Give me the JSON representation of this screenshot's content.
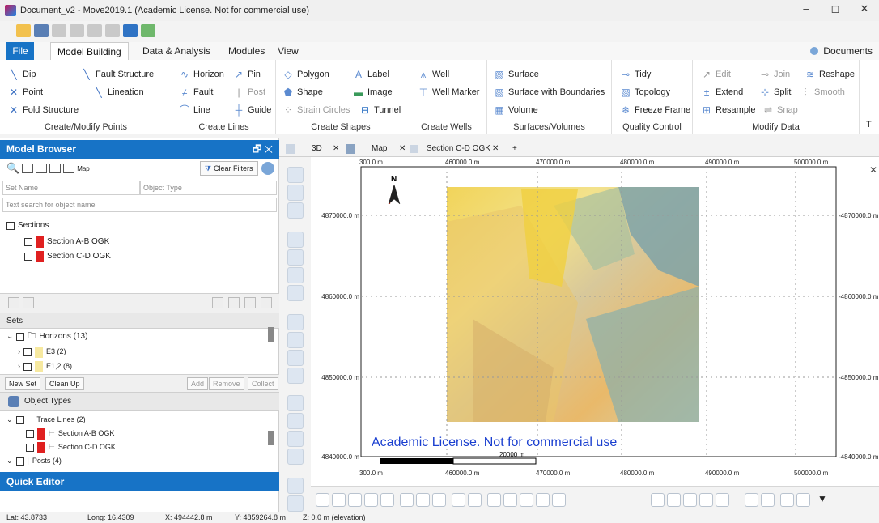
{
  "window": {
    "title": "Document_v2 - Move2019.1 (Academic License. Not for commercial use)",
    "minimize": "–",
    "restore": "◻",
    "close": "✕"
  },
  "ribbon_tabs": [
    "File",
    "Model Building",
    "Data & Analysis",
    "Modules",
    "View"
  ],
  "documents_label": "Documents",
  "ribbon": {
    "points": {
      "dip": "Dip",
      "fault_structure": "Fault Structure",
      "point": "Point",
      "lineation": "Lineation",
      "fold_structure": "Fold Structure",
      "label": "Create/Modify Points"
    },
    "lines": {
      "horizon": "Horizon",
      "pin": "Pin",
      "fault": "Fault",
      "post": "Post",
      "line": "Line",
      "guide": "Guide",
      "label": "Create Lines"
    },
    "shapes": {
      "polygon": "Polygon",
      "label_btn": "Label",
      "shape": "Shape",
      "image": "Image",
      "strain_circles": "Strain Circles",
      "tunnel": "Tunnel",
      "label": "Create Shapes"
    },
    "wells": {
      "well": "Well",
      "well_marker": "Well Marker",
      "label": "Create Wells"
    },
    "surfaces": {
      "surface": "Surface",
      "surface_boundaries": "Surface with Boundaries",
      "volume": "Volume",
      "label": "Surfaces/Volumes"
    },
    "quality": {
      "tidy": "Tidy",
      "topology": "Topology",
      "freeze_frame": "Freeze Frame",
      "label": "Quality Control"
    },
    "modify": {
      "edit": "Edit",
      "join": "Join",
      "reshape": "Reshape",
      "extend": "Extend",
      "split": "Split",
      "smooth": "Smooth",
      "resample": "Resample",
      "snap": "Snap",
      "label": "Modify Data"
    },
    "trunc": "T"
  },
  "model_browser": {
    "title": "Model Browser",
    "map_label": "Map",
    "clear_filters": "Clear Filters",
    "set_name_placeholder": "Set Name",
    "object_type_placeholder": "Object Type",
    "search_placeholder": "Text search for object name",
    "sections_label": "Sections",
    "sections": [
      {
        "name": "Section A-B OGK",
        "color": "#e02020"
      },
      {
        "name": "Section C-D OGK",
        "color": "#e02020"
      }
    ],
    "sets_label": "Sets",
    "horizons_label": "Horizons (13)",
    "horizon_items": [
      {
        "name": "E3 (2)",
        "color": "#f7e9a0"
      },
      {
        "name": "E1,2 (8)",
        "color": "#f7e9a0"
      }
    ],
    "buttons": {
      "new_set": "New Set",
      "clean_up": "Clean Up",
      "add": "Add",
      "remove": "Remove",
      "collect": "Collect"
    },
    "object_types_label": "Object Types",
    "trace_lines_label": "Trace Lines (2)",
    "trace_items": [
      "Section A-B OGK",
      "Section C-D OGK"
    ],
    "posts_label": "Posts (4)"
  },
  "quick_editor": "Quick Editor",
  "view_tabs": {
    "three_d": "3D",
    "map": "Map",
    "section": "Section C-D OGK",
    "plus": "+"
  },
  "map": {
    "north": "N",
    "x_ticks": [
      "300.0 m",
      "460000.0 m",
      "470000.0 m",
      "480000.0 m",
      "490000.0 m",
      "500000.0 m"
    ],
    "y_ticks": [
      "4870000.0 m",
      "4860000.0 m",
      "4850000.0 m",
      "4840000.0 m"
    ],
    "watermark": "Academic License. Not for commercial use",
    "scale_label": "20000 m",
    "close": "✕"
  },
  "status": {
    "lat": "Lat: 43.8733",
    "long": "Long: 16.4309",
    "x": "X: 494442.8 m",
    "y": "Y: 4859264.8 m",
    "z": "Z: 0.0 m (elevation)"
  }
}
